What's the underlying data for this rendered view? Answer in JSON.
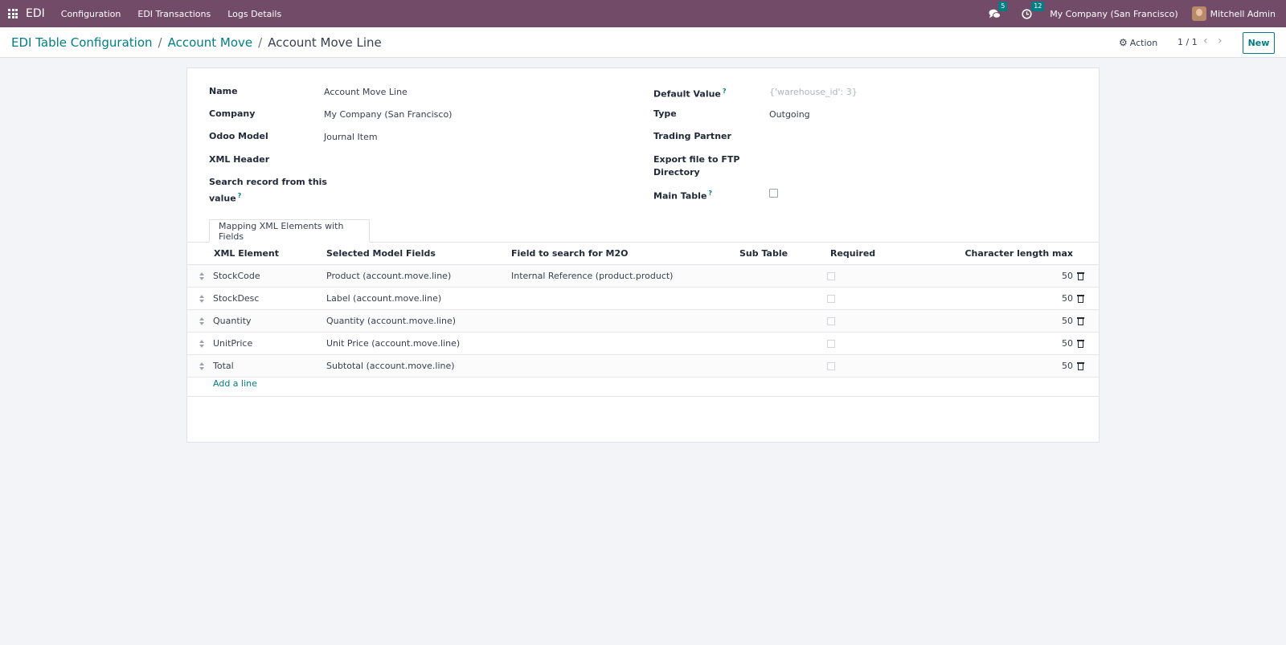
{
  "navbar": {
    "brand": "EDI",
    "menu": [
      "Configuration",
      "EDI Transactions",
      "Logs Details"
    ],
    "messages_count": "5",
    "activities_count": "12",
    "company": "My Company (San Francisco)",
    "user": "Mitchell Admin"
  },
  "breadcrumb": {
    "items": [
      "EDI Table Configuration",
      "Account Move"
    ],
    "current": "Account Move Line"
  },
  "control": {
    "action_label": "Action",
    "pager": "1 / 1",
    "new_label": "New"
  },
  "form": {
    "left": {
      "name_label": "Name",
      "name_value": "Account Move Line",
      "company_label": "Company",
      "company_value": "My Company (San Francisco)",
      "model_label": "Odoo Model",
      "model_value": "Journal Item",
      "xml_header_label": "XML Header",
      "search_label_1": "Search record from this",
      "search_label_2": "value"
    },
    "right": {
      "default_value_label": "Default Value",
      "default_value_placeholder": "{'warehouse_id': 3}",
      "type_label": "Type",
      "type_value": "Outgoing",
      "partner_label": "Trading Partner",
      "export_label_1": "Export file to FTP",
      "export_label_2": "Directory",
      "main_table_label": "Main Table",
      "main_table_checked": false
    },
    "help_mark": "?"
  },
  "tab": {
    "label": "Mapping XML Elements with Fields"
  },
  "table": {
    "headers": {
      "xml_element": "XML Element",
      "selected_fields": "Selected Model Fields",
      "search_field": "Field to search for M2O",
      "sub_table": "Sub Table",
      "required": "Required",
      "max_length": "Character length max"
    },
    "rows": [
      {
        "xml": "StockCode",
        "field": "Product (account.move.line)",
        "m2o": "Internal Reference (product.product)",
        "sub": "",
        "required": false,
        "len": "50"
      },
      {
        "xml": "StockDesc",
        "field": "Label (account.move.line)",
        "m2o": "",
        "sub": "",
        "required": false,
        "len": "50"
      },
      {
        "xml": "Quantity",
        "field": "Quantity (account.move.line)",
        "m2o": "",
        "sub": "",
        "required": false,
        "len": "50"
      },
      {
        "xml": "UnitPrice",
        "field": "Unit Price (account.move.line)",
        "m2o": "",
        "sub": "",
        "required": false,
        "len": "50"
      },
      {
        "xml": "Total",
        "field": "Subtotal (account.move.line)",
        "m2o": "",
        "sub": "",
        "required": false,
        "len": "50"
      }
    ],
    "add_line": "Add a line"
  },
  "colors": {
    "navbar": "#714b67",
    "accent": "#017e84",
    "background": "#f3f4f8"
  },
  "icons": [
    "apps-grid-icon",
    "chat-bubbles-icon",
    "clock-icon",
    "gear-icon",
    "chevron-left-icon",
    "chevron-right-icon",
    "drag-handle-icon",
    "trash-icon"
  ]
}
